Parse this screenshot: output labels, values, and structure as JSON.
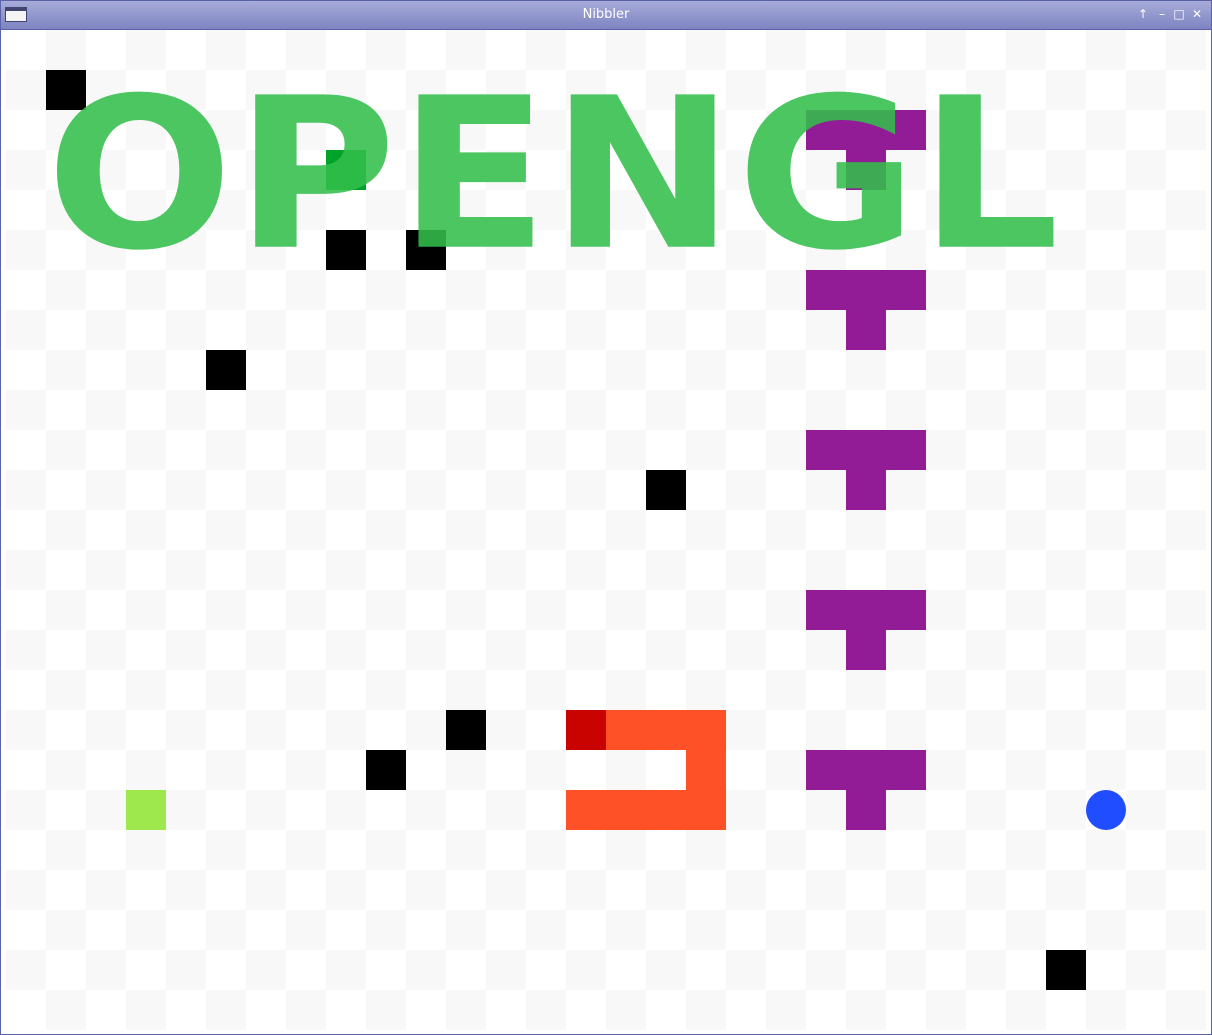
{
  "window": {
    "title": "Nibbler",
    "buttons": {
      "shade": "↑",
      "minimize": "–",
      "maximize": "□",
      "close": "✕"
    }
  },
  "logo": {
    "text": "OPENGL",
    "color": "#3cc05a"
  },
  "colors": {
    "obstacle": "#000000",
    "wall": "#921b96",
    "snake_body": "#ff5128",
    "snake_head": "#c90400",
    "food_green": "#00a32a",
    "bonus_light_green": "#9ee84e",
    "blue_ball": "#1f4dff"
  },
  "grid": {
    "columns": 30,
    "rows": 25
  },
  "obstacles": [
    [
      1,
      1
    ],
    [
      8,
      5
    ],
    [
      10,
      5
    ],
    [
      5,
      8
    ],
    [
      16,
      11
    ],
    [
      11,
      17
    ],
    [
      9,
      18
    ],
    [
      26,
      23
    ]
  ],
  "walls": [
    {
      "col": 20,
      "row": 2
    },
    {
      "col": 20,
      "row": 6
    },
    {
      "col": 20,
      "row": 10
    },
    {
      "col": 20,
      "row": 14
    },
    {
      "col": 20,
      "row": 18
    }
  ],
  "snake": {
    "head": [
      14,
      17
    ],
    "body": [
      [
        15,
        17
      ],
      [
        16,
        17
      ],
      [
        17,
        17
      ],
      [
        17,
        18
      ],
      [
        17,
        19
      ],
      [
        16,
        19
      ],
      [
        15,
        19
      ],
      [
        14,
        19
      ]
    ]
  },
  "food": [
    [
      8,
      3
    ]
  ],
  "bonus": [
    [
      3,
      19
    ]
  ],
  "ball": [
    27,
    19
  ]
}
